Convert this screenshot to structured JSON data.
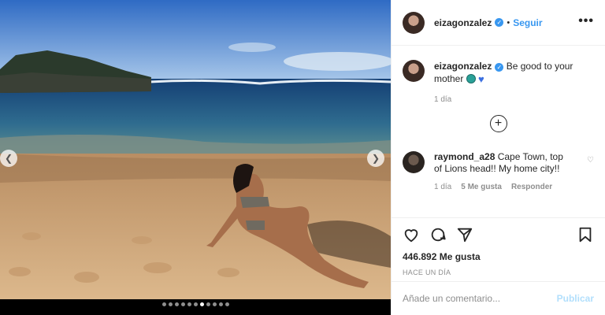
{
  "post": {
    "username": "eizagonzalez",
    "separator": "•",
    "follow_label": "Seguir",
    "more_label": "•••",
    "caption_text": "Be good to your mother",
    "caption_time": "1 día",
    "load_more_icon": "plus-circle-icon",
    "comment": {
      "username": "raymond_a28",
      "text": "Cape Town, top of Lions head!! My home city!!",
      "time": "1 día",
      "likes": "5 Me gusta",
      "reply_label": "Responder"
    },
    "likes_count": "446.892 Me gusta",
    "timestamp": "HACE UN DÍA",
    "add_comment_placeholder": "Añade un comentario...",
    "publish_label": "Publicar",
    "carousel": {
      "total": 11,
      "active": 6
    },
    "colors": {
      "accent": "#3897f0",
      "publish_disabled": "#b2dffc",
      "muted": "#8e8e8e"
    }
  }
}
